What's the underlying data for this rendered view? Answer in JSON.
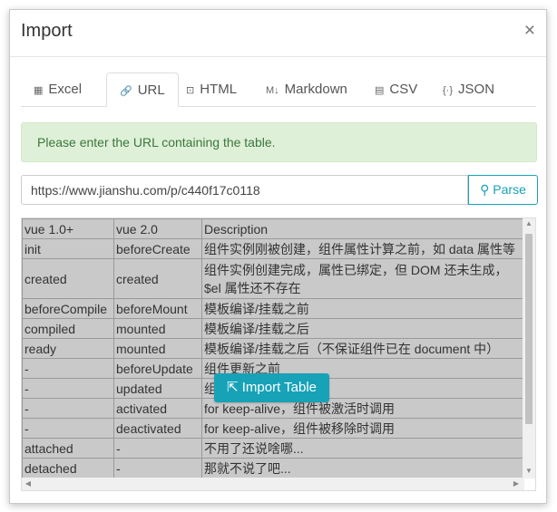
{
  "dialog": {
    "title": "Import",
    "close": "×"
  },
  "tabs": [
    {
      "icon": "▦",
      "label": "Excel"
    },
    {
      "icon": "🔗",
      "label": "URL"
    },
    {
      "icon": "⊡",
      "label": "HTML"
    },
    {
      "icon": "M↓",
      "label": "Markdown"
    },
    {
      "icon": "▤",
      "label": "CSV"
    },
    {
      "icon": "{·}",
      "label": "JSON"
    }
  ],
  "active_tab": "URL",
  "alert": {
    "text": "Please enter the URL containing the table."
  },
  "url": {
    "value": "https://www.jianshu.com/p/c440f17c0118",
    "parse_icon": "⚲",
    "parse_label": "Parse"
  },
  "table": {
    "rows": [
      [
        "vue 1.0+",
        "vue 2.0",
        "Description"
      ],
      [
        "init",
        "beforeCreate",
        "组件实例刚被创建，组件属性计算之前，如 data 属性等"
      ],
      [
        "created",
        "created",
        "组件实例创建完成，属性已绑定，但 DOM 还未生成，\n$el 属性还不存在"
      ],
      [
        "beforeCompile",
        "beforeMount",
        "模板编译/挂载之前"
      ],
      [
        "compiled",
        "mounted",
        "模板编译/挂载之后"
      ],
      [
        "ready",
        "mounted",
        "模板编译/挂载之后（不保证组件已在 document 中）"
      ],
      [
        "-",
        "beforeUpdate",
        "组件更新之前"
      ],
      [
        "-",
        "updated",
        "组件更新之后"
      ],
      [
        "-",
        "activated",
        "for keep-alive，组件被激活时调用"
      ],
      [
        "-",
        "deactivated",
        "for keep-alive，组件被移除时调用"
      ],
      [
        "attached",
        "-",
        "不用了还说啥哪..."
      ],
      [
        "detached",
        "-",
        "那就不说了吧..."
      ]
    ]
  },
  "import_button": {
    "icon": "⇱",
    "label": "Import Table"
  }
}
